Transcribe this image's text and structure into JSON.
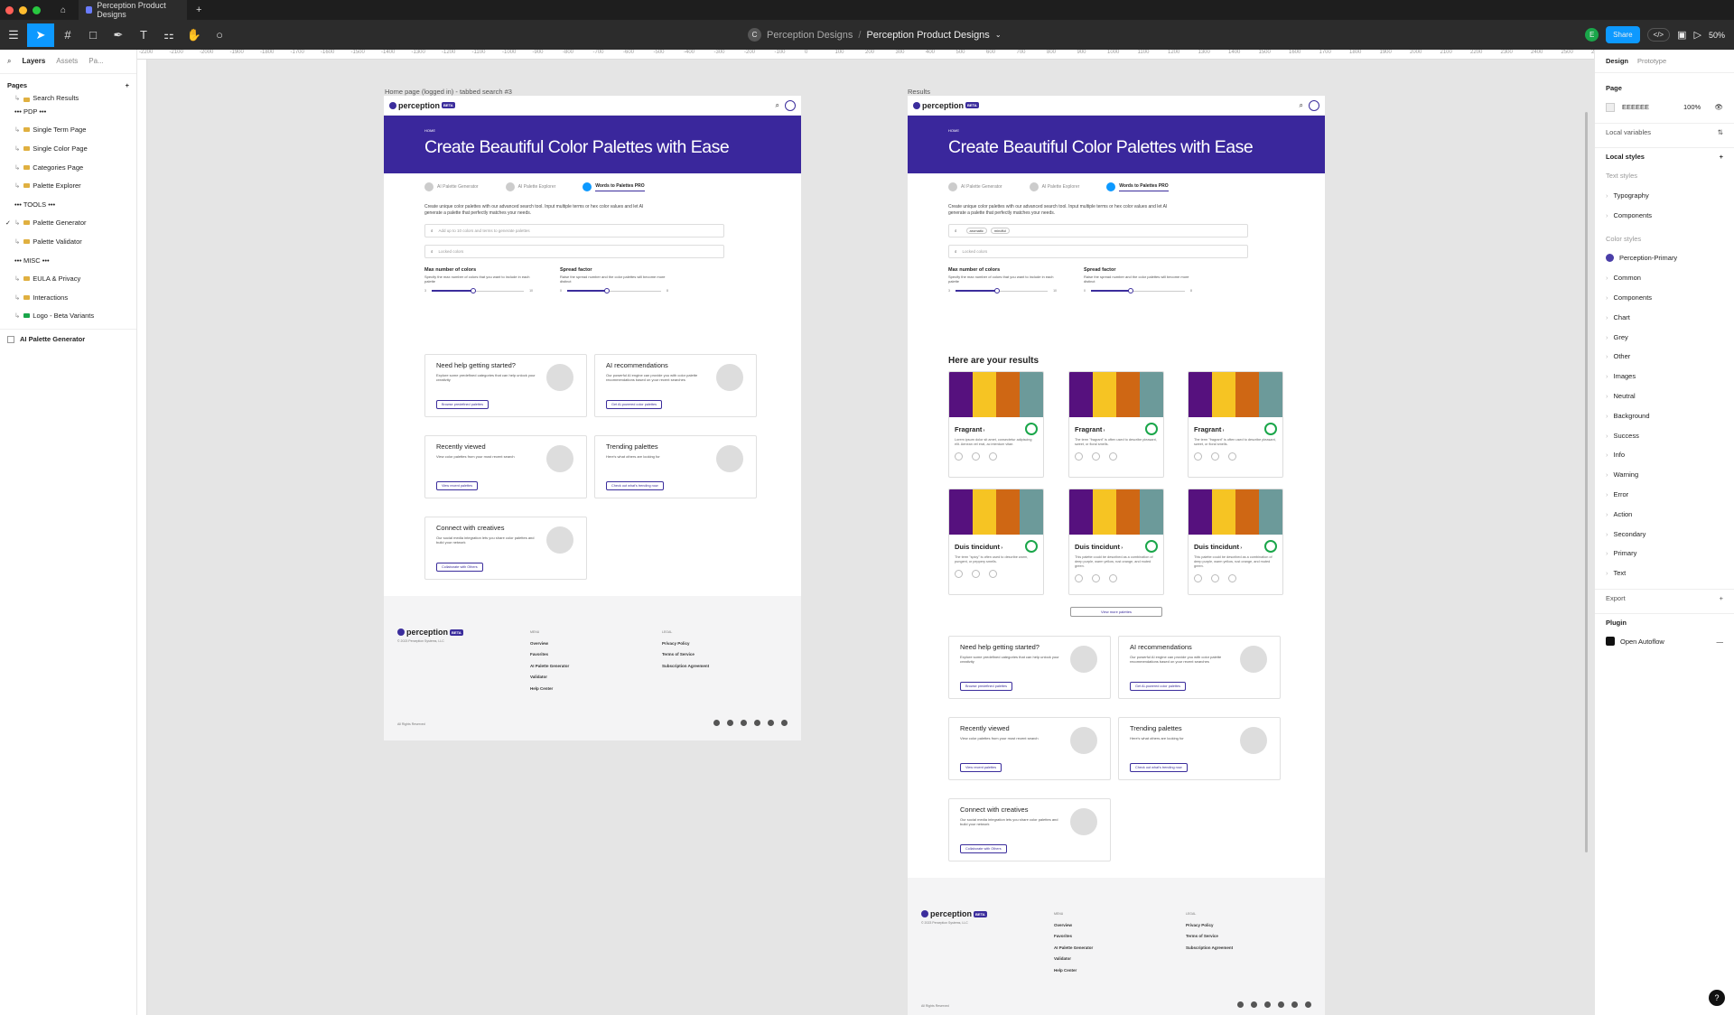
{
  "tabbar": {
    "title": "Perception Product Designs",
    "home_icon": "home-icon",
    "new_tab": "+"
  },
  "toolbar": {
    "breadcrumb_team": "Perception Designs",
    "breadcrumb_sep": "/",
    "file_name": "Perception Product Designs",
    "share": "Share",
    "zoom": "50%",
    "team_initial": "C",
    "user_initial": "E"
  },
  "left": {
    "tab_layers": "Layers",
    "tab_assets": "Assets",
    "tab_page": "Pa...",
    "pages_title": "Pages",
    "add": "+",
    "pages": [
      "Search Results",
      "••• PDP •••",
      "Single Term Page",
      "Single Color Page",
      "Categories Page",
      "Palette Explorer",
      "••• TOOLS •••",
      "Palette Generator",
      "Palette Validator",
      "••• MISC •••",
      "EULA & Privacy",
      "Interactions",
      "Logo - Beta Variants"
    ],
    "layer": "AI Palette Generator"
  },
  "ruler": [
    "-2200",
    "-2100",
    "-2000",
    "-1900",
    "-1800",
    "-1700",
    "-1600",
    "-1500",
    "-1400",
    "-1300",
    "-1200",
    "-1100",
    "-1000",
    "-900",
    "-800",
    "-700",
    "-600",
    "-500",
    "-400",
    "-300",
    "-200",
    "-100",
    "0",
    "100",
    "200",
    "300",
    "400",
    "500",
    "600",
    "700",
    "800",
    "900",
    "1000",
    "1100",
    "1200",
    "1300",
    "1400",
    "1500",
    "1600",
    "1700",
    "1800",
    "1900",
    "2000",
    "2100",
    "2200",
    "2300",
    "2400",
    "2500",
    "2600"
  ],
  "frame1": {
    "label": "Home page (logged in) - tabbed search #3"
  },
  "frame2": {
    "label": "Results"
  },
  "site": {
    "logo": "perception",
    "beta": "BETA",
    "home": "HOME",
    "hero": "Create Beautiful Color Palettes with Ease",
    "tab1": "AI Palette Generator",
    "tab2": "AI Palette Explorer",
    "tab3": "Words to Palettes PRO",
    "desc": "Create unique color palettes with our advanced search tool. Input multiple terms or hex color values and let AI generate a palette that perfectly matches your needs.",
    "search_ph": "Add up to 10 colors and terms to generate palettes",
    "locked_ph": "Locked colors",
    "chip1": "aromatic",
    "chip2": "mindful",
    "max_title": "Max number of colors",
    "max_desc": "Specify the max number of colors that you want to include in each palette",
    "max_min": "3",
    "max_max": "10",
    "max_value_fraction": 0.45,
    "spread_title": "Spread factor",
    "spread_desc": "Raise the spread number and the color palettes will become more distinct",
    "spread_min": "0",
    "spread_max": "8",
    "spread_value_fraction": 0.42,
    "cards": [
      {
        "title": "Need help getting started?",
        "desc": "Explore some predefined categories that can help unlock your creativity",
        "btn": "Browse predefined palettes"
      },
      {
        "title": "AI recommendations",
        "desc": "Our powerful AI engine can provide you with color palette recommendations based on your recent searches",
        "btn": "Get AI-powered color palettes"
      },
      {
        "title": "Recently viewed",
        "desc": "View color palettes from your most recent search",
        "btn": "View recent palettes"
      },
      {
        "title": "Trending palettes",
        "desc": "Here's what others are looking for",
        "btn": "Check out what's trending now"
      },
      {
        "title": "Connect with creatives",
        "desc": "Our social media integration lets you share color palettes and build your network",
        "btn": "Collaborate with Others"
      }
    ],
    "footer": {
      "copy": "© 2023 Perception Systems, LLC",
      "menu": "MENU",
      "legal": "LEGAL",
      "menu_items": [
        "Overview",
        "Favorites",
        "AI Palette Generator",
        "Validator",
        "Help Center"
      ],
      "legal_items": [
        "Privacy Policy",
        "Terms of Service",
        "Subscription Agreement"
      ],
      "rights": "All Rights Reserved"
    },
    "results_title": "Here are your results",
    "results": [
      {
        "name": "Fragrant",
        "desc": "Lorem ipsum dolor sit amet, consectetur adipiscing elit. Aenean vel erat, ac interdum vitae."
      },
      {
        "name": "Fragrant",
        "desc": "The term \"fragrant\" is often used to describe pleasant, sweet, or floral smells."
      },
      {
        "name": "Fragrant",
        "desc": "The term \"fragrant\" is often used to describe pleasant, sweet, or floral smells."
      },
      {
        "name": "Duis tincidunt",
        "desc": "The term \"spicy\" is often used to describe warm, pungent, or peppery smells."
      },
      {
        "name": "Duis tincidunt",
        "desc": "This palette could be described as a combination of deep purple, warm yellow, rust orange, and muted green."
      },
      {
        "name": "Duis tincidunt",
        "desc": "This palette could be described as a combination of deep purple, warm yellow, rust orange, and muted green."
      }
    ],
    "view_more": "View more palettes",
    "swatch_colors": [
      "#56117e",
      "#f6c423",
      "#cf6714",
      "#6c9a9a"
    ]
  },
  "right": {
    "tab_design": "Design",
    "tab_prototype": "Prototype",
    "page": "Page",
    "page_color": "EEEEEE",
    "page_opacity": "100%",
    "local_vars": "Local variables",
    "local_styles": "Local styles",
    "text_styles": "Text styles",
    "text": [
      "Typography",
      "Components"
    ],
    "color_styles": "Color styles",
    "colors": [
      "Perception-Primary",
      "Common",
      "Components",
      "Chart",
      "Grey",
      "Other",
      "Images",
      "Neutral",
      "Background",
      "Success",
      "Info",
      "Warning",
      "Error",
      "Action",
      "Secondary",
      "Primary",
      "Text"
    ],
    "export": "Export",
    "plugin": "Plugin",
    "plugin_item": "Open Autoflow",
    "help": "?"
  },
  "colors": {
    "accent": "#3a279c",
    "share": "#0d99ff",
    "primary_swatch": "#4a3ea8"
  }
}
